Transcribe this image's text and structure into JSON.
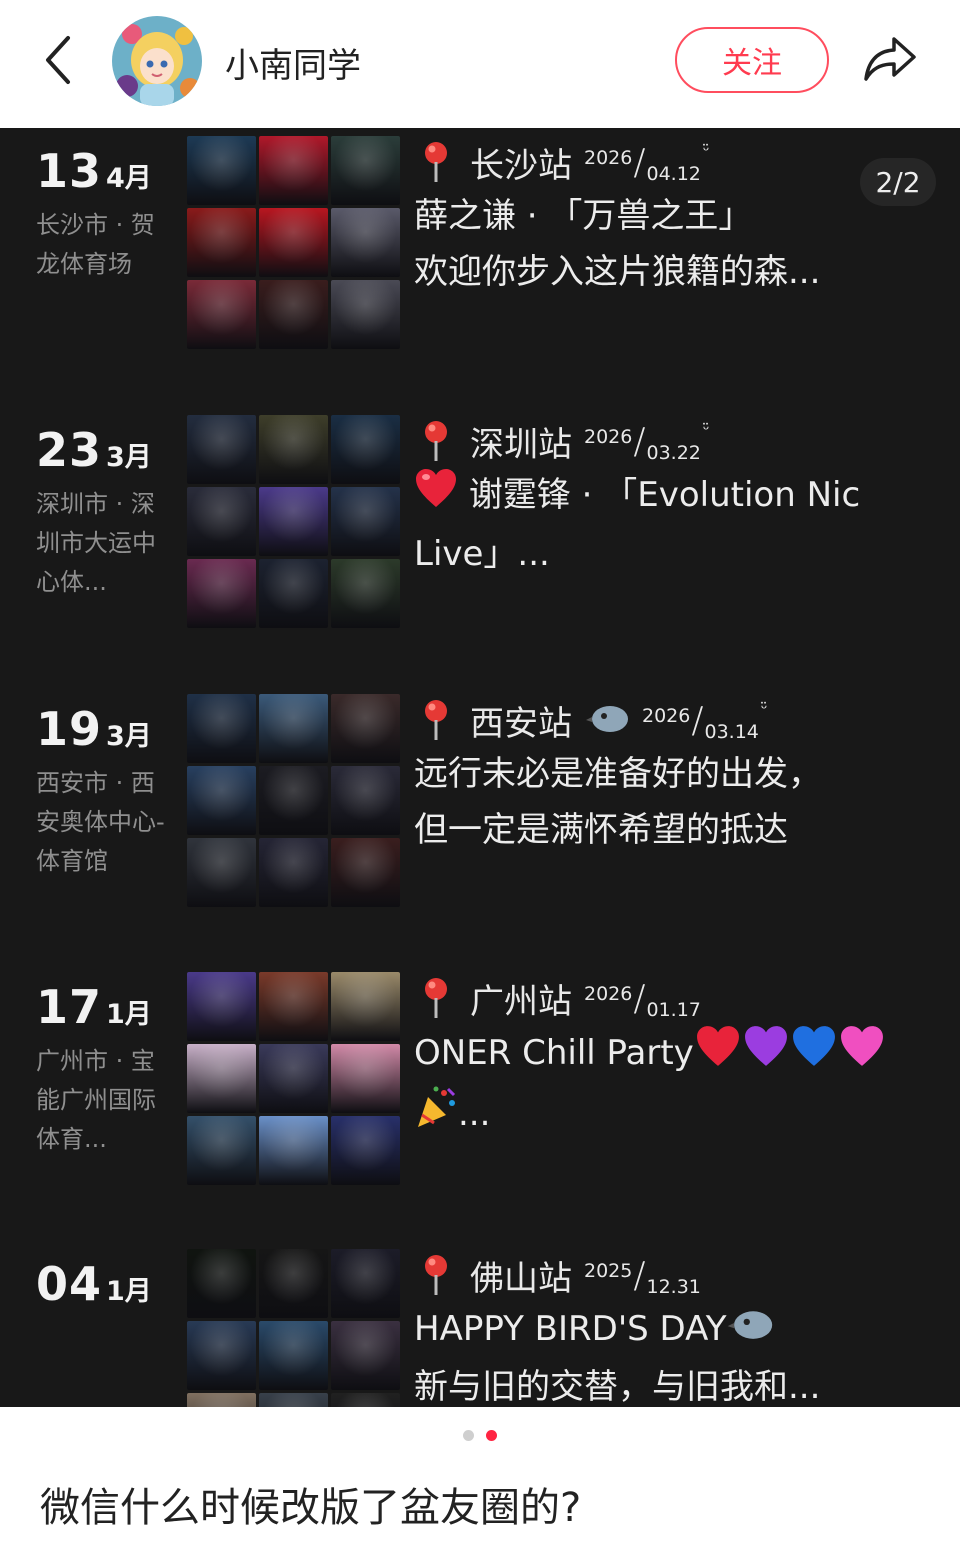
{
  "header": {
    "username": "小南同学",
    "follow_label": "关注"
  },
  "pager": "2/2",
  "entries": [
    {
      "day": "13",
      "month": "4月",
      "place": "长沙市 · 贺龙体育场",
      "city": "长沙站",
      "year": "2026",
      "md": "04.12",
      "smile": "ᵕ̈",
      "line1": "薛之谦 · 「万兽之王」",
      "line2": "欢迎你步入这片狼籍的森...",
      "colors": [
        "#1d3a55",
        "#b0182a",
        "#2b3d3a",
        "#8a1a1a",
        "#b81620",
        "#5a5a6a",
        "#7a2a38",
        "#3a1d1d",
        "#4a4a55"
      ]
    },
    {
      "day": "23",
      "month": "3月",
      "place": "深圳市 · 深圳市大运中心体...",
      "city": "深圳站",
      "year": "2026",
      "md": "03.22",
      "smile": "ᵕ̈",
      "line1": "谢霆锋 · 「Evolution Nic",
      "line2": "Live」...",
      "colors": [
        "#232d3f",
        "#3e3e2a",
        "#1a2e44",
        "#2a2c3a",
        "#4b3a8a",
        "#24324a",
        "#6a2a50",
        "#1c2230",
        "#2c3a2a"
      ]
    },
    {
      "day": "19",
      "month": "3月",
      "place": "西安市 · 西安奥体中心-体育馆",
      "city": "西安站",
      "year": "2026",
      "md": "03.14",
      "smile": "ᵕ̈",
      "line1": "远行未必是准备好的出发，",
      "line2": "但一定是满怀希望的抵达",
      "colors": [
        "#1f3047",
        "#3b5a7a",
        "#3a2a2a",
        "#284060",
        "#1c1c22",
        "#2a2a38",
        "#30343c",
        "#252535",
        "#3a1e1e"
      ]
    },
    {
      "day": "17",
      "month": "1月",
      "place": "广州市 · 宝能广州国际体育...",
      "city": "广州站",
      "year": "2026",
      "md": "01.17",
      "smile": "",
      "line1": "ONER Chill Party",
      "line2": "...",
      "colors": [
        "#4a3a8a",
        "#7a3a2a",
        "#9a8a6a",
        "#c8b0c8",
        "#3a3a5a",
        "#d28aa8",
        "#34506a",
        "#6a90c8",
        "#28306a"
      ]
    },
    {
      "day": "04",
      "month": "1月",
      "place": "",
      "city": "佛山站",
      "year": "2025",
      "md": "12.31",
      "smile": "",
      "line1": "HAPPY BIRD'S DAY",
      "line2": "新与旧的交替，与旧我和...",
      "colors": [
        "#101410",
        "#161616",
        "#1c1c28",
        "#283a55",
        "#2a4a6a",
        "#3a3040",
        "#807060",
        "#38404a",
        "#202020"
      ]
    }
  ],
  "caption": "微信什么时候改版了盆友圈的?"
}
